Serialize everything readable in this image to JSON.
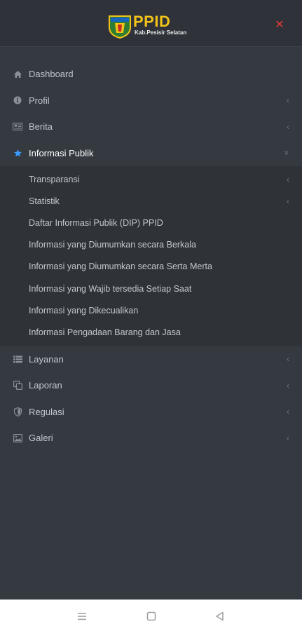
{
  "header": {
    "logo_title": "PPID",
    "logo_subtitle": "Kab.Pesisir Selatan",
    "close_icon": "close-icon",
    "close_color": "#e53935"
  },
  "colors": {
    "background": "#343a40",
    "header_bg": "#2f3339",
    "submenu_bg": "#2f3338",
    "active_icon": "#3b9cff",
    "logo_yellow": "#f2c318"
  },
  "menu": {
    "items": [
      {
        "label": "Dashboard",
        "icon": "home-icon"
      },
      {
        "label": "Profil",
        "icon": "info-circle-icon",
        "chevron": "‹"
      },
      {
        "label": "Berita",
        "icon": "newspaper-icon",
        "chevron": "‹"
      },
      {
        "label": "Informasi Publik",
        "icon": "star-icon",
        "chevron": "»"
      },
      {
        "label": "Layanan",
        "icon": "list-icon",
        "chevron": "‹"
      },
      {
        "label": "Laporan",
        "icon": "copy-icon",
        "chevron": "‹"
      },
      {
        "label": "Regulasi",
        "icon": "shield-icon",
        "chevron": "‹"
      },
      {
        "label": "Galeri",
        "icon": "image-icon",
        "chevron": "‹"
      }
    ],
    "submenu": [
      {
        "label": "Transparansi",
        "chevron": "‹"
      },
      {
        "label": "Statistik",
        "chevron": "‹"
      },
      {
        "label": "Daftar Informasi Publik (DIP) PPID"
      },
      {
        "label": "Informasi yang Diumumkan secara Berkala"
      },
      {
        "label": "Informasi yang Diumumkan secara Serta Merta"
      },
      {
        "label": "Informasi yang Wajib tersedia Setiap Saat"
      },
      {
        "label": "Informasi yang Dikecualikan"
      },
      {
        "label": "Informasi Pengadaan Barang dan Jasa"
      }
    ]
  },
  "system_nav": {
    "menu_icon": "menu-icon",
    "home_icon": "home-square-icon",
    "back_icon": "back-triangle-icon"
  }
}
